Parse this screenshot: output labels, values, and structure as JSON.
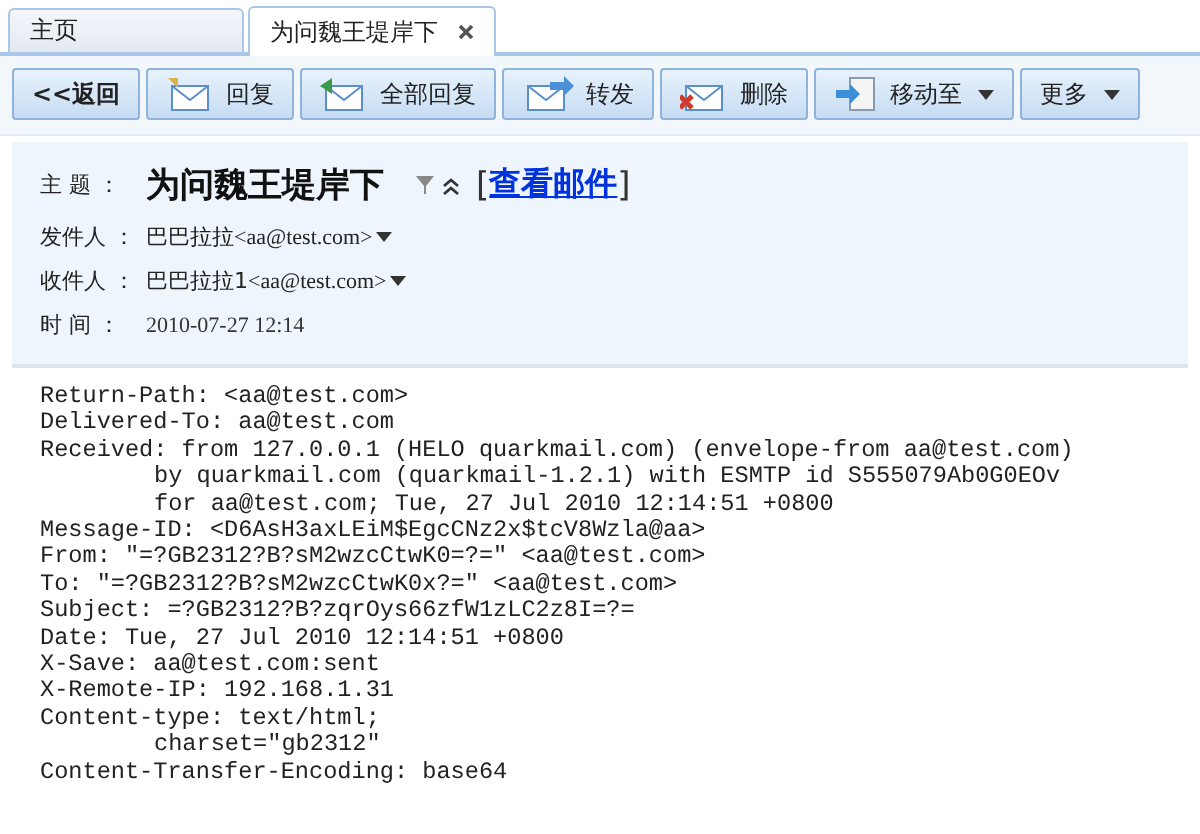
{
  "tabs": [
    {
      "label": "主页",
      "selected": false,
      "closable": false
    },
    {
      "label": "为问魏王堤岸下",
      "selected": true,
      "closable": true
    }
  ],
  "toolbar": [
    {
      "label": "<<返回",
      "kind": "back",
      "dropdown": false
    },
    {
      "label": "回复",
      "kind": "reply",
      "dropdown": false
    },
    {
      "label": "全部回复",
      "kind": "reply-all",
      "dropdown": false
    },
    {
      "label": "转发",
      "kind": "forward",
      "dropdown": false
    },
    {
      "label": "删除",
      "kind": "delete",
      "dropdown": false
    },
    {
      "label": "移动至",
      "kind": "move",
      "dropdown": true
    },
    {
      "label": "更多",
      "kind": "more",
      "dropdown": true
    }
  ],
  "header": {
    "subject": {
      "label": "主 题 ：",
      "value": "为问魏王堤岸下",
      "link_open": "[",
      "link": "查看邮件",
      "link_close": "]"
    },
    "sender": {
      "label": "发件人 ：",
      "name": "巴巴拉拉",
      "address": "<aa@test.com>"
    },
    "recipient": {
      "label": "收件人 ：",
      "name": "巴巴拉拉1",
      "address": "<aa@test.com>"
    },
    "time": {
      "label": "时 间 ：",
      "value": "2010-07-27 12:14"
    }
  },
  "source_lines": [
    {
      "text": "Return-Path: <aa@test.com>",
      "indent": false
    },
    {
      "text": "Delivered-To: aa@test.com",
      "indent": false
    },
    {
      "text": "Received: from 127.0.0.1 (HELO quarkmail.com) (envelope-from aa@test.com)",
      "indent": false
    },
    {
      "text": "by quarkmail.com (quarkmail-1.2.1) with ESMTP id S555079Ab0G0EOv",
      "indent": true
    },
    {
      "text": "for aa@test.com; Tue, 27 Jul 2010 12:14:51 +0800",
      "indent": true
    },
    {
      "text": "Message-ID: <D6AsH3axLEiM$EgcCNz2x$tcV8Wzla@aa>",
      "indent": false
    },
    {
      "text": "From: \"=?GB2312?B?sM2wzcCtwK0=?=\" <aa@test.com>",
      "indent": false
    },
    {
      "text": "To: \"=?GB2312?B?sM2wzcCtwK0x?=\" <aa@test.com>",
      "indent": false
    },
    {
      "text": "Subject: =?GB2312?B?zqrOys66zfW1zLC2z8I=?=",
      "indent": false
    },
    {
      "text": "Date: Tue, 27 Jul 2010 12:14:51 +0800",
      "indent": false
    },
    {
      "text": "X-Save: aa@test.com:sent",
      "indent": false
    },
    {
      "text": "X-Remote-IP: 192.168.1.31",
      "indent": false
    },
    {
      "text": "Content-type: text/html;",
      "indent": false
    },
    {
      "text": "charset=\"gb2312\"",
      "indent": true
    },
    {
      "text": "Content-Transfer-Encoding: base64",
      "indent": false
    }
  ]
}
